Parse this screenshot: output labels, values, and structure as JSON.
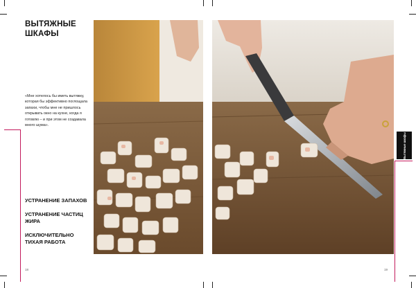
{
  "page": {
    "title_line1": "ВЫТЯЖНЫЕ",
    "title_line2": "ШКАФЫ",
    "quote": "«Мне хотелось бы иметь вытяжку, которая бы эффективно поглощала запахи, чтобы мне не пришлось открывать окно на кухне, когда я готовлю – и при этом не создавала много шума».",
    "features": [
      "УСТРАНЕНИЕ ЗАПАХОВ",
      "УСТРАНЕНИЕ ЧАСТИЦ ЖИРА",
      "ИСКЛЮЧИТЕЛЬНО ТИХАЯ РАБОТА"
    ],
    "folio_left": "18",
    "folio_right": "19",
    "side_tab_label": "Вытяжные шкафы"
  },
  "colors": {
    "accent": "#c2185b",
    "board": "#7a5a3a",
    "wall": "#c6903f"
  },
  "images": {
    "left_photo": "chopped-shrimp-on-cutting-board-photo",
    "right_photo": "hands-chopping-shrimp-with-knife-photo"
  }
}
